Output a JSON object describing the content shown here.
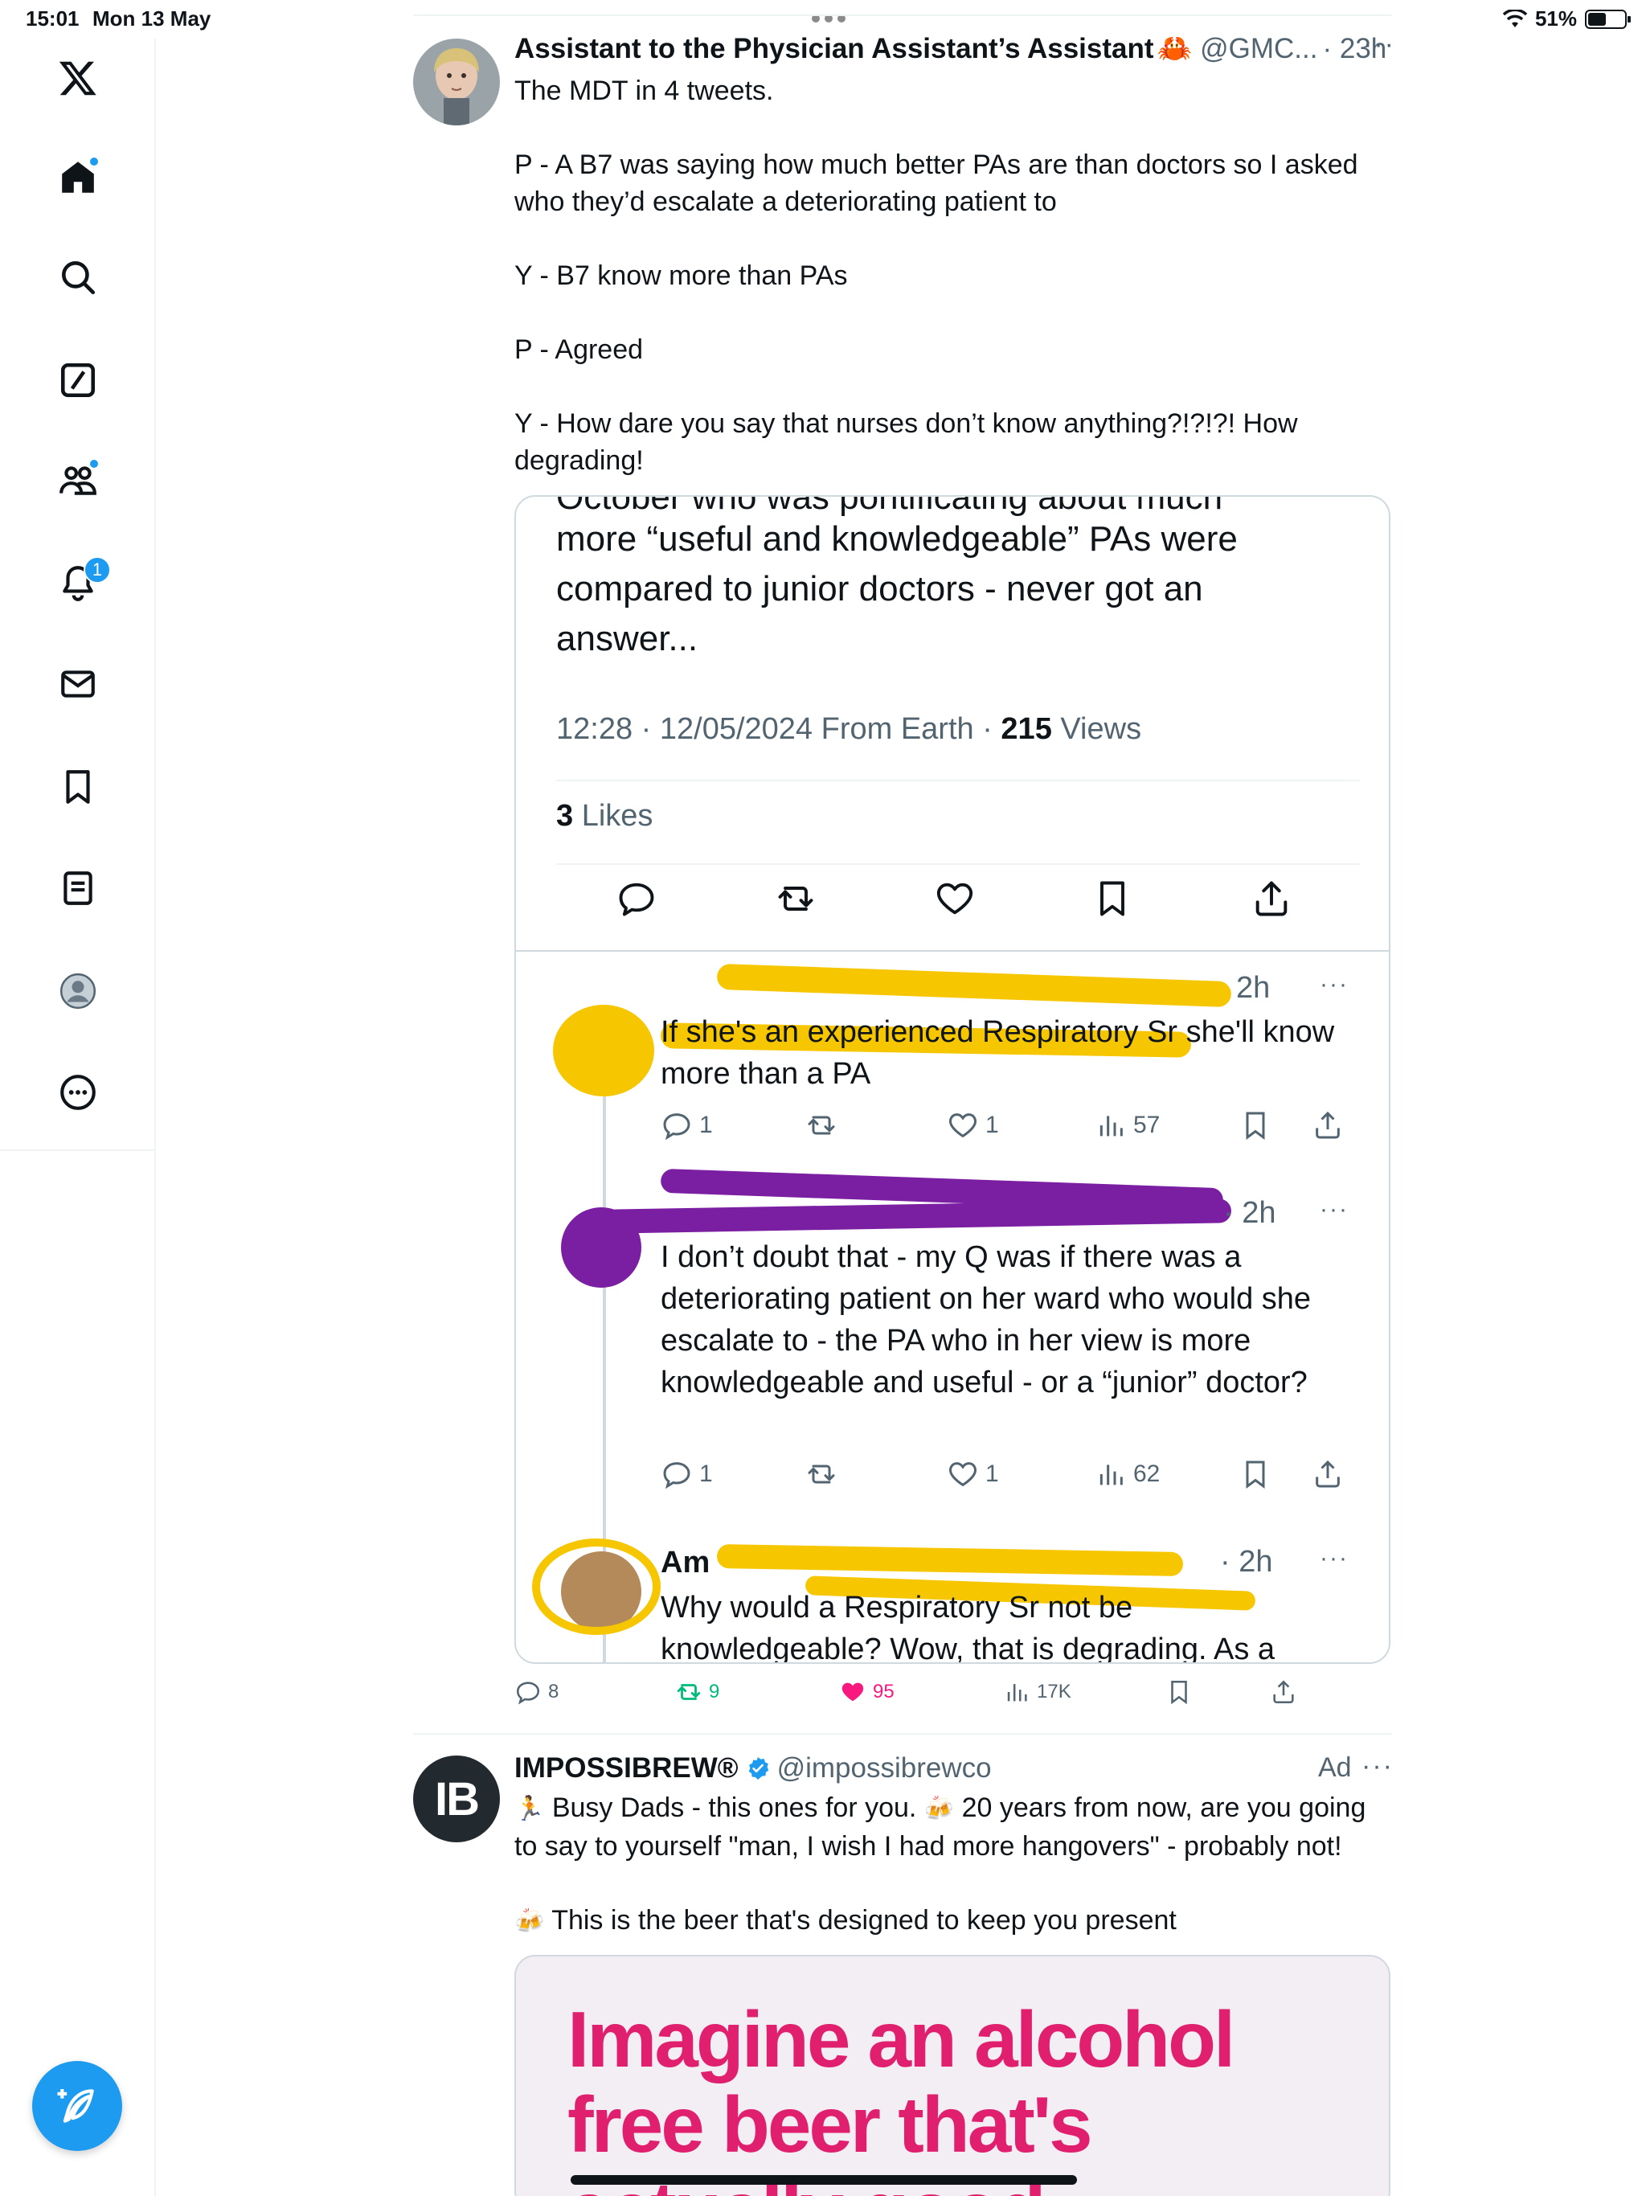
{
  "status_bar": {
    "time": "15:01",
    "date": "Mon 13 May",
    "battery": "51%",
    "battery_level": 0.51
  },
  "sidebar": {
    "items": [
      {
        "name": "x-logo-icon"
      },
      {
        "name": "home-icon",
        "badge": "dot"
      },
      {
        "name": "search-icon"
      },
      {
        "name": "grok-icon"
      },
      {
        "name": "communities-icon",
        "badge": "dot"
      },
      {
        "name": "notifications-icon",
        "badge": "1"
      },
      {
        "name": "messages-icon"
      },
      {
        "name": "bookmarks-icon"
      },
      {
        "name": "lists-icon"
      },
      {
        "name": "profile-icon"
      },
      {
        "name": "more-icon"
      }
    ],
    "compose_icon": "compose-icon"
  },
  "tweet1": {
    "name": "Assistant to the Physician Assistant’s Assistant",
    "name_emoji": "🦀",
    "handle": "@GMC...",
    "time": "· 23h",
    "lines": [
      "The MDT in 4 tweets.",
      "",
      "P - A B7 was saying how much better PAs are than doctors so I asked who they’d escalate a deteriorating patient to",
      "",
      "Y - B7 know more than PAs",
      "",
      "P - Agreed",
      "",
      "Y - How dare you say that nurses don’t know anything?!?!?! How degrading!"
    ],
    "screenshot": {
      "cut_line": "October who was pontificating about much",
      "text": "more “useful and knowledgeable” PAs were compared to junior doctors - never got an answer...",
      "meta_prefix": "12:28 · 12/05/2024 From Earth · ",
      "views_count": "215",
      "views_label": " Views",
      "likes_count": "3",
      "likes_label": " Likes",
      "replies": [
        {
          "time": "2h",
          "text": "If she's an experienced Respiratory Sr she'll know more than a PA",
          "reply_count": "1",
          "like_count": "1",
          "views": "57"
        },
        {
          "time": "· 2h",
          "text": "I don’t doubt that - my Q was if there was a deteriorating patient on her ward who would she escalate to - the PA who in her view is more knowledgeable and useful - or a “junior” doctor?",
          "reply_count": "1",
          "like_count": "1",
          "views": "62"
        },
        {
          "name_fragment": "Am",
          "time": "· 2h",
          "text": "Why would a Respiratory Sr not be knowledgeable? Wow, that is degrading. As a"
        }
      ]
    },
    "actions": {
      "replies": "8",
      "reposts": "9",
      "likes": "95",
      "views": "17K"
    },
    "colors": {
      "repost_active": "#00ba7c",
      "like_active": "#f91880",
      "scribble_yellow": "#f6c600",
      "scribble_purple": "#7b1fa2"
    }
  },
  "tweet2": {
    "name": "IMPOSSIBREW®",
    "handle": "@impossibrewco",
    "ad_label": "Ad",
    "avatar_text": "IB",
    "line1": "Busy Dads - this ones for you.",
    "line1_b": "20 years from now, are you going to say to yourself  \"man, I wish I had more hangovers\" - probably not!",
    "line2": "This is the beer that's designed to keep you present",
    "emoji_runner": "🏃",
    "emoji_beer": "🍻",
    "card_headline_1": "Imagine an alcohol",
    "card_headline_2": "free beer that's",
    "card_headline_3": "actually good",
    "accent": "#e0206f"
  }
}
